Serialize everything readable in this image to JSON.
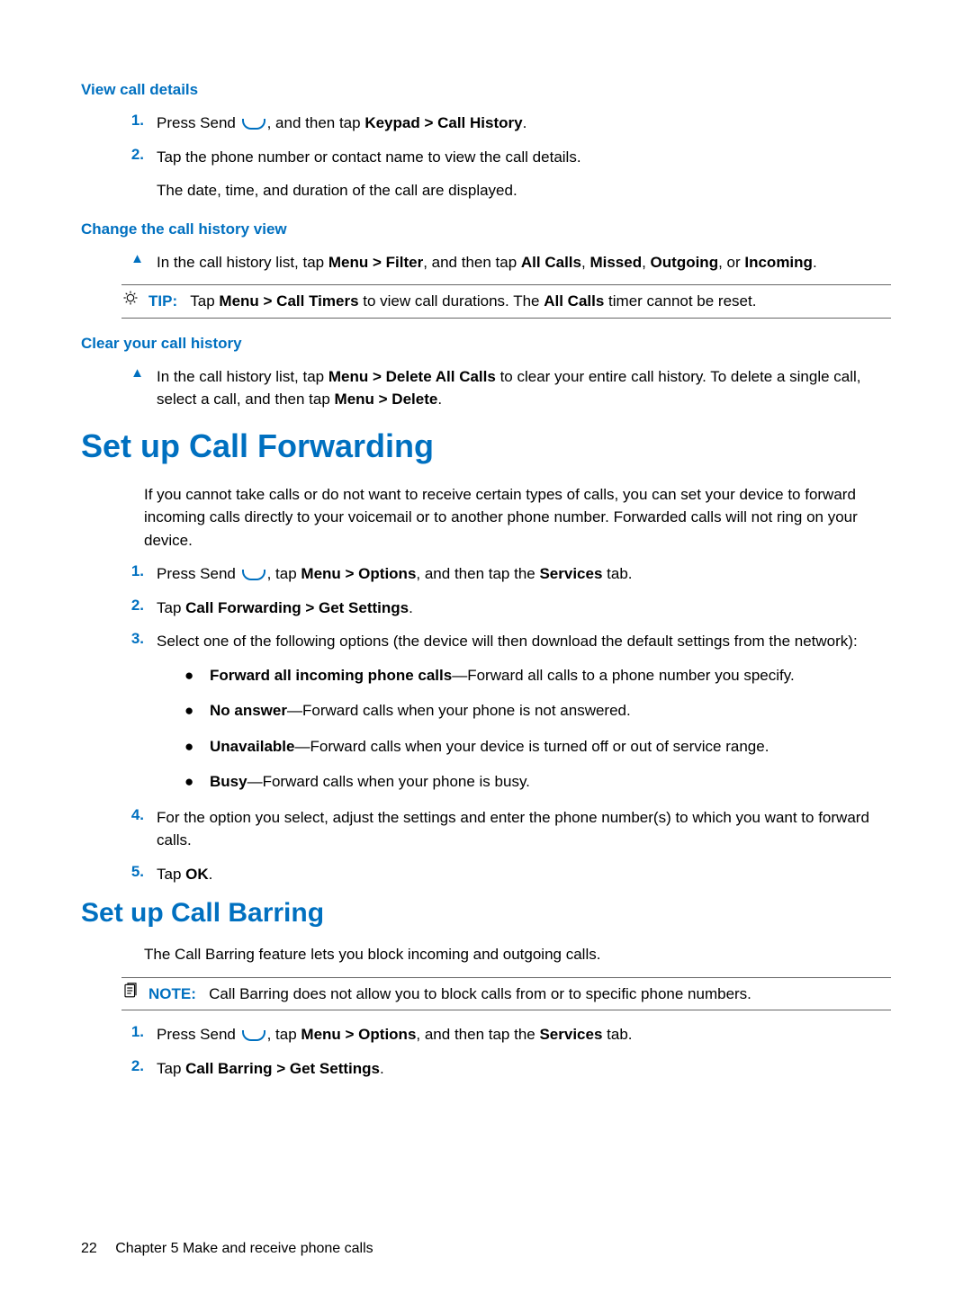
{
  "section1": {
    "heading": "View call details",
    "steps": [
      {
        "num": "1.",
        "pre": "Press Send ",
        "post": ", and then tap ",
        "bold1": "Keypad > Call History",
        "end": "."
      },
      {
        "num": "2.",
        "text": "Tap the phone number or contact name to view the call details."
      }
    ],
    "after": "The date, time, and duration of the call are displayed."
  },
  "section2": {
    "heading": "Change the call history view",
    "bullet": {
      "pre": "In the call history list, tap ",
      "bold1": "Menu > Filter",
      "mid1": ", and then tap ",
      "bold2": "All Calls",
      "mid2": ", ",
      "bold3": "Missed",
      "mid3": ", ",
      "bold4": "Outgoing",
      "mid4": ", or ",
      "bold5": "Incoming",
      "end": "."
    },
    "tip": {
      "label": "TIP:",
      "pre": "Tap ",
      "bold1": "Menu > Call Timers",
      "mid1": " to view call durations. The ",
      "bold2": "All Calls",
      "end": " timer cannot be reset."
    }
  },
  "section3": {
    "heading": "Clear your call history",
    "bullet": {
      "pre": "In the call history list, tap ",
      "bold1": "Menu > Delete All Calls",
      "mid1": " to clear your entire call history. To delete a single call, select a call, and then tap ",
      "bold2": "Menu > Delete",
      "end": "."
    }
  },
  "section4": {
    "heading": "Set up Call Forwarding",
    "intro": "If you cannot take calls or do not want to receive certain types of calls, you can set your device to forward incoming calls directly to your voicemail or to another phone number. Forwarded calls will not ring on your device.",
    "steps": [
      {
        "num": "1.",
        "pre": "Press Send ",
        "mid1": ", tap ",
        "bold1": "Menu > Options",
        "mid2": ", and then tap the ",
        "bold2": "Services",
        "end": " tab."
      },
      {
        "num": "2.",
        "pre": "Tap ",
        "bold1": "Call Forwarding > Get Settings",
        "end": "."
      },
      {
        "num": "3.",
        "text": "Select one of the following options (the device will then download the default settings from the network):"
      }
    ],
    "bullets": [
      {
        "bold": "Forward all incoming phone calls",
        "rest": "—Forward all calls to a phone number you specify."
      },
      {
        "bold": "No answer",
        "rest": "—Forward calls when your phone is not answered."
      },
      {
        "bold": "Unavailable",
        "rest": "—Forward calls when your device is turned off or out of service range."
      },
      {
        "bold": "Busy",
        "rest": "—Forward calls when your phone is busy."
      }
    ],
    "steps2": [
      {
        "num": "4.",
        "text": "For the option you select, adjust the settings and enter the phone number(s) to which you want to forward calls."
      },
      {
        "num": "5.",
        "pre": "Tap ",
        "bold1": "OK",
        "end": "."
      }
    ]
  },
  "section5": {
    "heading": "Set up Call Barring",
    "intro": "The Call Barring feature lets you block incoming and outgoing calls.",
    "note": {
      "label": "NOTE:",
      "text": "Call Barring does not allow you to block calls from or to specific phone numbers."
    },
    "steps": [
      {
        "num": "1.",
        "pre": "Press Send ",
        "mid1": ", tap ",
        "bold1": "Menu > Options",
        "mid2": ", and then tap the ",
        "bold2": "Services",
        "end": " tab."
      },
      {
        "num": "2.",
        "pre": "Tap ",
        "bold1": "Call Barring > Get Settings",
        "end": "."
      }
    ]
  },
  "footer": {
    "page": "22",
    "chapter": "Chapter 5   Make and receive phone calls"
  }
}
